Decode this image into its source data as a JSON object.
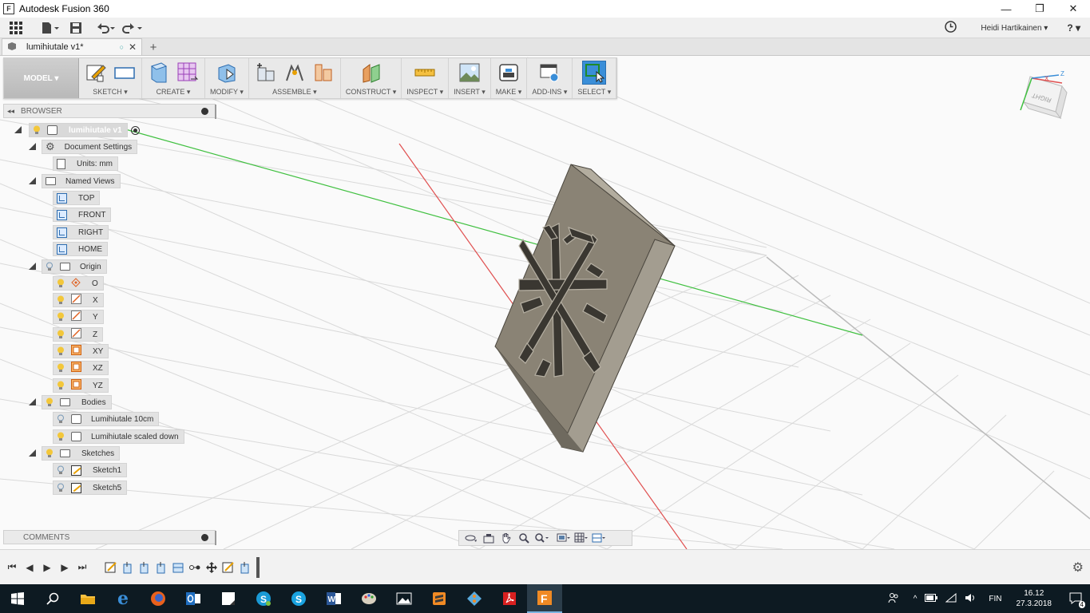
{
  "window": {
    "title": "Autodesk Fusion 360",
    "minimize_glyph": "—",
    "restore_glyph": "❐",
    "close_glyph": "✕"
  },
  "quick_access": {
    "user_name": "Heidi Hartikainen ▾",
    "help_label": "? ▾"
  },
  "document_tab": {
    "name": "lumihiutale v1*",
    "new_tab_glyph": "+"
  },
  "workspace": {
    "label": "MODEL ▾"
  },
  "toolbar": {
    "groups": [
      {
        "label": "SKETCH ▾"
      },
      {
        "label": "CREATE ▾"
      },
      {
        "label": "MODIFY ▾"
      },
      {
        "label": "ASSEMBLE ▾"
      },
      {
        "label": "CONSTRUCT ▾"
      },
      {
        "label": "INSPECT ▾"
      },
      {
        "label": "INSERT ▾"
      },
      {
        "label": "MAKE ▾"
      },
      {
        "label": "ADD-INS ▾"
      },
      {
        "label": "SELECT ▾"
      }
    ]
  },
  "browser": {
    "title": "BROWSER",
    "collapse_glyph": "◂◂",
    "root": "lumihiutale v1",
    "document_settings": "Document Settings",
    "units": "Units: mm",
    "named_views": "Named Views",
    "views": [
      "TOP",
      "FRONT",
      "RIGHT",
      "HOME"
    ],
    "origin": "Origin",
    "origin_items": [
      "O",
      "X",
      "Y",
      "Z",
      "XY",
      "XZ",
      "YZ"
    ],
    "bodies": "Bodies",
    "body_items": [
      "Lumihiutale 10cm",
      "Lumihiutale scaled down"
    ],
    "sketches": "Sketches",
    "sketch_items": [
      "Sketch1",
      "Sketch5"
    ]
  },
  "comments": {
    "title": "COMMENTS"
  },
  "viewcube": {
    "face_label": "RIGHT",
    "axis_x": "X",
    "axis_z": "Z"
  },
  "taskbar": {
    "language": "FIN",
    "time": "16.12",
    "date": "27.3.2018",
    "notification_count": "4"
  },
  "colors": {
    "accent_blue": "#3a8ed8",
    "model_face": "#8a8375",
    "model_side": "#a39d90",
    "axis_red": "#e05050",
    "axis_green": "#40c040"
  }
}
